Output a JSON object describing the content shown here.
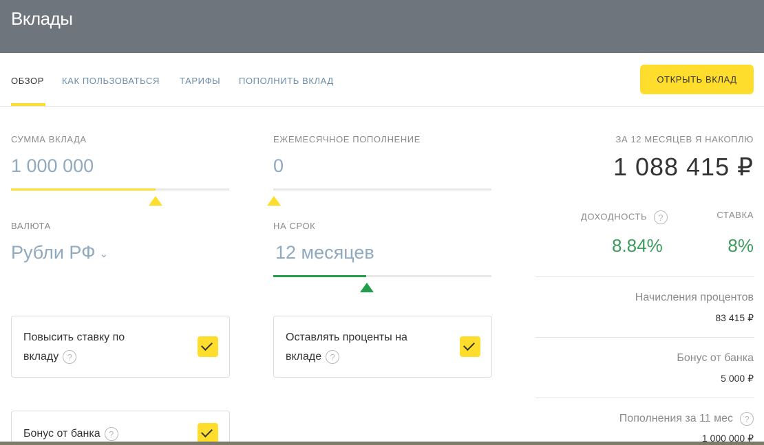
{
  "header": {
    "title": "Вклады"
  },
  "tabs": [
    {
      "label": "Обзор",
      "active": true
    },
    {
      "label": "Как пользоваться",
      "active": false
    },
    {
      "label": "Тарифы",
      "active": false
    },
    {
      "label": "Пополнить вклад",
      "active": false
    }
  ],
  "open_button": {
    "label": "Открыть вклад"
  },
  "form": {
    "deposit_amount": {
      "label": "Сумма вклада",
      "value": "1 000 000",
      "slider_fraction": 0.66
    },
    "monthly_topup": {
      "label": "Ежемесячное пополнение",
      "value": "0",
      "slider_fraction": 0.0
    },
    "currency": {
      "label": "Валюта",
      "value": "Рубли РФ"
    },
    "term": {
      "label": "На срок",
      "value": "12 месяцев",
      "slider_fraction": 0.425
    }
  },
  "options": [
    {
      "line1": "Повысить ставку по",
      "line2": "вкладу",
      "checked": true
    },
    {
      "line1": "Оставлять проценты на",
      "line2": "вкладе",
      "checked": true
    },
    {
      "line1": "Бонус от банка",
      "checked": true
    }
  ],
  "summary": {
    "accumulate_label": "За 12 месяцев я накоплю",
    "total": "1 088 415 ₽",
    "yield_label": "Доходность",
    "yield_value": "8.84%",
    "rate_label": "Ставка",
    "rate_value": "8%",
    "rows": [
      {
        "title": "Начисления процентов",
        "amount": "83 415 ₽"
      },
      {
        "title": "Бонус от банка",
        "amount": "5 000 ₽"
      },
      {
        "title": "Пополнения за 11 мес",
        "amount": "1 000 000 ₽"
      }
    ]
  },
  "colors": {
    "header": "#6e757c",
    "accent": "#ffdd2d",
    "link": "#6b8ca8",
    "green": "#3c9c5c"
  },
  "icons": {
    "help": "question-circle-icon",
    "check": "check-icon",
    "chevron": "chevron-down-icon"
  }
}
